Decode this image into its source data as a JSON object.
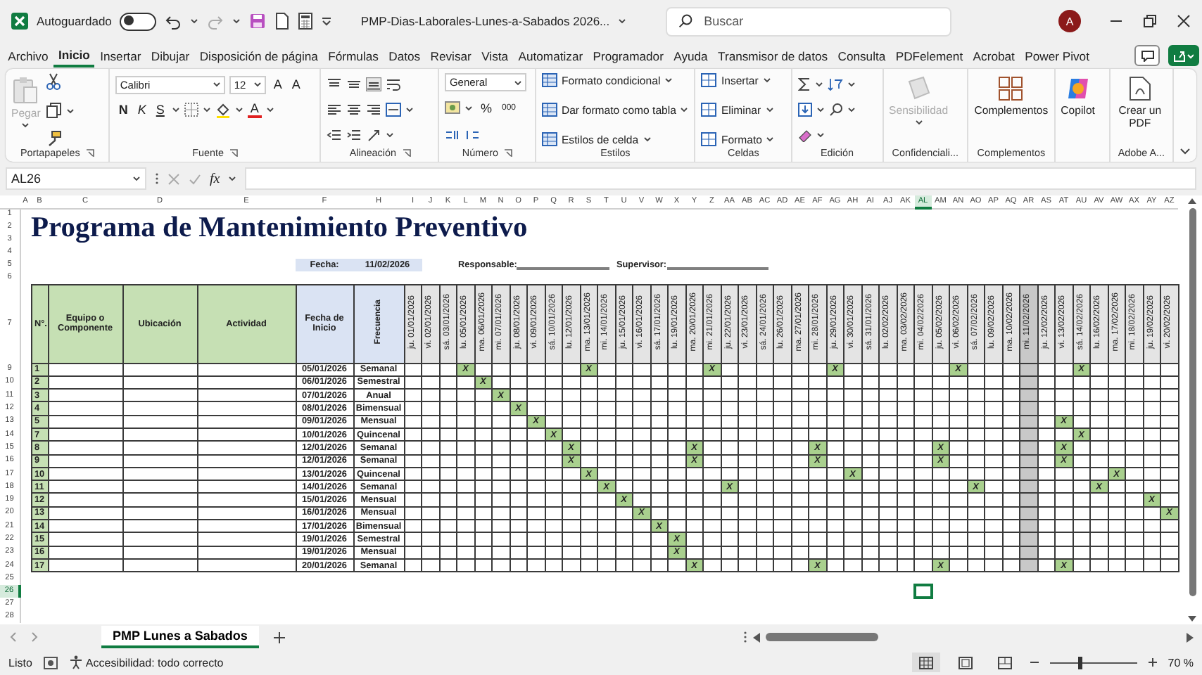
{
  "title_bar": {
    "autosave_label": "Autoguardado",
    "autosave_on": false,
    "file_name": "PMP-Dias-Laborales-Lunes-a-Sabados 2026...",
    "search_placeholder": "Buscar",
    "avatar": "A"
  },
  "menu_tabs": [
    {
      "label": "Archivo",
      "selected": false
    },
    {
      "label": "Inicio",
      "selected": true
    },
    {
      "label": "Insertar",
      "selected": false
    },
    {
      "label": "Dibujar",
      "selected": false
    },
    {
      "label": "Disposición de página",
      "selected": false
    },
    {
      "label": "Fórmulas",
      "selected": false
    },
    {
      "label": "Datos",
      "selected": false
    },
    {
      "label": "Revisar",
      "selected": false
    },
    {
      "label": "Vista",
      "selected": false
    },
    {
      "label": "Automatizar",
      "selected": false
    },
    {
      "label": "Programador",
      "selected": false
    },
    {
      "label": "Ayuda",
      "selected": false
    },
    {
      "label": "Transmisor de datos",
      "selected": false
    },
    {
      "label": "Consulta",
      "selected": false
    },
    {
      "label": "PDFelement",
      "selected": false
    },
    {
      "label": "Acrobat",
      "selected": false
    },
    {
      "label": "Power Pivot",
      "selected": false
    }
  ],
  "ribbon": {
    "clipboard": {
      "paste": "Pegar",
      "label": "Portapapeles"
    },
    "font": {
      "name": "Calibri",
      "size": "12",
      "grow": "A",
      "shrink": "A",
      "bold": "N",
      "italic": "K",
      "underline": "S",
      "font_color_button": "A",
      "label": "Fuente"
    },
    "alignment": {
      "label": "Alineación"
    },
    "number": {
      "format": "General",
      "percent": "%",
      "thousands": "000",
      "label": "Número"
    },
    "styles": {
      "items": [
        "Formato condicional",
        "Dar formato como tabla",
        "Estilos de celda"
      ],
      "label": "Estilos"
    },
    "cells": {
      "items": [
        "Insertar",
        "Eliminar",
        "Formato"
      ],
      "label": "Celdas"
    },
    "editing": {
      "label": "Edición"
    },
    "sensitivity": {
      "button": "Sensibilidad",
      "disabled": true,
      "label": "Confidenciali..."
    },
    "addins": {
      "button": "Complementos",
      "label": "Complementos"
    },
    "copilot": {
      "button": "Copilot"
    },
    "adobe": {
      "button": "Crear un PDF",
      "label": "Adobe A..."
    }
  },
  "formula_bar": {
    "name_box": "AL26",
    "function_label": "fx"
  },
  "sheet": {
    "column_letters": [
      {
        "label": "A",
        "selected": false
      },
      {
        "label": "B",
        "selected": false
      },
      {
        "label": "C",
        "selected": false
      },
      {
        "label": "D",
        "selected": false
      },
      {
        "label": "E",
        "selected": false
      },
      {
        "label": "F",
        "selected": false
      },
      {
        "label": "H",
        "selected": false
      },
      {
        "label": "I",
        "selected": false
      },
      {
        "label": "J",
        "selected": false
      },
      {
        "label": "K",
        "selected": false
      },
      {
        "label": "L",
        "selected": false
      },
      {
        "label": "M",
        "selected": false
      },
      {
        "label": "N",
        "selected": false
      },
      {
        "label": "O",
        "selected": false
      },
      {
        "label": "P",
        "selected": false
      },
      {
        "label": "Q",
        "selected": false
      },
      {
        "label": "R",
        "selected": false
      },
      {
        "label": "S",
        "selected": false
      },
      {
        "label": "T",
        "selected": false
      },
      {
        "label": "U",
        "selected": false
      },
      {
        "label": "V",
        "selected": false
      },
      {
        "label": "W",
        "selected": false
      },
      {
        "label": "X",
        "selected": false
      },
      {
        "label": "Y",
        "selected": false
      },
      {
        "label": "Z",
        "selected": false
      },
      {
        "label": "AA",
        "selected": false
      },
      {
        "label": "AB",
        "selected": false
      },
      {
        "label": "AC",
        "selected": false
      },
      {
        "label": "AD",
        "selected": false
      },
      {
        "label": "AE",
        "selected": false
      },
      {
        "label": "AF",
        "selected": false
      },
      {
        "label": "AG",
        "selected": false
      },
      {
        "label": "AH",
        "selected": false
      },
      {
        "label": "AI",
        "selected": false
      },
      {
        "label": "AJ",
        "selected": false
      },
      {
        "label": "AK",
        "selected": false
      },
      {
        "label": "AL",
        "selected": true
      },
      {
        "label": "AM",
        "selected": false
      },
      {
        "label": "AN",
        "selected": false
      },
      {
        "label": "AO",
        "selected": false
      },
      {
        "label": "AP",
        "selected": false
      },
      {
        "label": "AQ",
        "selected": false
      },
      {
        "label": "AR",
        "selected": false
      },
      {
        "label": "AS",
        "selected": false
      },
      {
        "label": "AT",
        "selected": false
      },
      {
        "label": "AU",
        "selected": false
      },
      {
        "label": "AV",
        "selected": false
      },
      {
        "label": "AW",
        "selected": false
      },
      {
        "label": "AX",
        "selected": false
      },
      {
        "label": "AY",
        "selected": false
      },
      {
        "label": "AZ",
        "selected": false
      }
    ],
    "row_numbers": [
      {
        "label": "1",
        "selected": false
      },
      {
        "label": "2",
        "selected": false
      },
      {
        "label": "3",
        "selected": false
      },
      {
        "label": "4",
        "selected": false
      },
      {
        "label": "5",
        "selected": false
      },
      {
        "label": "6",
        "selected": false
      },
      {
        "label": "7",
        "selected": false
      },
      {
        "label": "9",
        "selected": false
      },
      {
        "label": "10",
        "selected": false
      },
      {
        "label": "11",
        "selected": false
      },
      {
        "label": "12",
        "selected": false
      },
      {
        "label": "13",
        "selected": false
      },
      {
        "label": "14",
        "selected": false
      },
      {
        "label": "15",
        "selected": false
      },
      {
        "label": "16",
        "selected": false
      },
      {
        "label": "17",
        "selected": false
      },
      {
        "label": "18",
        "selected": false
      },
      {
        "label": "19",
        "selected": false
      },
      {
        "label": "20",
        "selected": false
      },
      {
        "label": "21",
        "selected": false
      },
      {
        "label": "22",
        "selected": false
      },
      {
        "label": "23",
        "selected": false
      },
      {
        "label": "24",
        "selected": false
      },
      {
        "label": "25",
        "selected": false
      },
      {
        "label": "26",
        "selected": true
      },
      {
        "label": "27",
        "selected": false
      },
      {
        "label": "28",
        "selected": false
      }
    ],
    "title": "Programa de Mantenimiento Preventivo",
    "fecha_label": "Fecha:",
    "fecha_value": "11/02/2026",
    "responsable_label": "Responsable:",
    "supervisor_label": "Supervisor:",
    "headers": [
      "N°.",
      "Equipo o Componente",
      "Ubicación",
      "Actividad",
      "Fecha de Inicio",
      "Frecuencia"
    ],
    "dates": [
      {
        "label": "ju. 01/01/2026",
        "highlighted": false
      },
      {
        "label": "vi. 02/01/2026",
        "highlighted": false
      },
      {
        "label": "sá. 03/01/2026",
        "highlighted": false
      },
      {
        "label": "lu. 05/01/2026",
        "highlighted": false
      },
      {
        "label": "ma. 06/01/2026",
        "highlighted": false
      },
      {
        "label": "mi. 07/01/2026",
        "highlighted": false
      },
      {
        "label": "ju. 08/01/2026",
        "highlighted": false
      },
      {
        "label": "vi. 09/01/2026",
        "highlighted": false
      },
      {
        "label": "sá. 10/01/2026",
        "highlighted": false
      },
      {
        "label": "lu. 12/01/2026",
        "highlighted": false
      },
      {
        "label": "ma. 13/01/2026",
        "highlighted": false
      },
      {
        "label": "mi. 14/01/2026",
        "highlighted": false
      },
      {
        "label": "ju. 15/01/2026",
        "highlighted": false
      },
      {
        "label": "vi. 16/01/2026",
        "highlighted": false
      },
      {
        "label": "sá. 17/01/2026",
        "highlighted": false
      },
      {
        "label": "lu. 19/01/2026",
        "highlighted": false
      },
      {
        "label": "ma. 20/01/2026",
        "highlighted": false
      },
      {
        "label": "mi. 21/01/2026",
        "highlighted": false
      },
      {
        "label": "ju. 22/01/2026",
        "highlighted": false
      },
      {
        "label": "vi. 23/01/2026",
        "highlighted": false
      },
      {
        "label": "sá. 24/01/2026",
        "highlighted": false
      },
      {
        "label": "lu. 26/01/2026",
        "highlighted": false
      },
      {
        "label": "ma. 27/01/2026",
        "highlighted": false
      },
      {
        "label": "mi. 28/01/2026",
        "highlighted": false
      },
      {
        "label": "ju. 29/01/2026",
        "highlighted": false
      },
      {
        "label": "vi. 30/01/2026",
        "highlighted": false
      },
      {
        "label": "sá. 31/01/2026",
        "highlighted": false
      },
      {
        "label": "lu. 02/02/2026",
        "highlighted": false
      },
      {
        "label": "ma. 03/02/2026",
        "highlighted": false
      },
      {
        "label": "mi. 04/02/2026",
        "highlighted": false
      },
      {
        "label": "ju. 05/02/2026",
        "highlighted": false
      },
      {
        "label": "vi. 06/02/2026",
        "highlighted": false
      },
      {
        "label": "sá. 07/02/2026",
        "highlighted": false
      },
      {
        "label": "lu. 09/02/2026",
        "highlighted": false
      },
      {
        "label": "ma. 10/02/2026",
        "highlighted": false
      },
      {
        "label": "mi. 11/02/2026",
        "highlighted": true
      },
      {
        "label": "ju. 12/02/2026",
        "highlighted": false
      },
      {
        "label": "vi. 13/02/2026",
        "highlighted": false
      },
      {
        "label": "sá. 14/02/2026",
        "highlighted": false
      },
      {
        "label": "lu. 16/02/2026",
        "highlighted": false
      },
      {
        "label": "ma. 17/02/2026",
        "highlighted": false
      },
      {
        "label": "mi. 18/02/2026",
        "highlighted": false
      },
      {
        "label": "ju. 19/02/2026",
        "highlighted": false
      },
      {
        "label": "vi. 20/02/2026",
        "highlighted": false
      }
    ],
    "rows": [
      {
        "no": "1",
        "fecha": "05/01/2026",
        "frecuencia": "Semanal",
        "mark_texts": [
          "X",
          "X",
          "X",
          "X",
          "X",
          "X"
        ],
        "marked": [
          false,
          false,
          false,
          true,
          false,
          false,
          false,
          false,
          false,
          false,
          true,
          false,
          false,
          false,
          false,
          false,
          false,
          true,
          false,
          false,
          false,
          false,
          false,
          false,
          true,
          false,
          false,
          false,
          false,
          false,
          false,
          true,
          false,
          false,
          false,
          false,
          false,
          false,
          true,
          false,
          false,
          false,
          false,
          false
        ]
      },
      {
        "no": "2",
        "fecha": "06/01/2026",
        "frecuencia": "Semestral",
        "mark_texts": [
          "X"
        ],
        "marked": [
          false,
          false,
          false,
          false,
          true,
          false,
          false,
          false,
          false,
          false,
          false,
          false,
          false,
          false,
          false,
          false,
          false,
          false,
          false,
          false,
          false,
          false,
          false,
          false,
          false,
          false,
          false,
          false,
          false,
          false,
          false,
          false,
          false,
          false,
          false,
          false,
          false,
          false,
          false,
          false,
          false,
          false,
          false,
          false
        ]
      },
      {
        "no": "3",
        "fecha": "07/01/2026",
        "frecuencia": "Anual",
        "mark_texts": [
          "X"
        ],
        "marked": [
          false,
          false,
          false,
          false,
          false,
          true,
          false,
          false,
          false,
          false,
          false,
          false,
          false,
          false,
          false,
          false,
          false,
          false,
          false,
          false,
          false,
          false,
          false,
          false,
          false,
          false,
          false,
          false,
          false,
          false,
          false,
          false,
          false,
          false,
          false,
          false,
          false,
          false,
          false,
          false,
          false,
          false,
          false,
          false
        ]
      },
      {
        "no": "4",
        "fecha": "08/01/2026",
        "frecuencia": "Bimensual",
        "mark_texts": [
          "X"
        ],
        "marked": [
          false,
          false,
          false,
          false,
          false,
          false,
          true,
          false,
          false,
          false,
          false,
          false,
          false,
          false,
          false,
          false,
          false,
          false,
          false,
          false,
          false,
          false,
          false,
          false,
          false,
          false,
          false,
          false,
          false,
          false,
          false,
          false,
          false,
          false,
          false,
          false,
          false,
          false,
          false,
          false,
          false,
          false,
          false,
          false
        ]
      },
      {
        "no": "5",
        "fecha": "09/01/2026",
        "frecuencia": "Mensual",
        "mark_texts": [
          "X",
          "X"
        ],
        "marked": [
          false,
          false,
          false,
          false,
          false,
          false,
          false,
          true,
          false,
          false,
          false,
          false,
          false,
          false,
          false,
          false,
          false,
          false,
          false,
          false,
          false,
          false,
          false,
          false,
          false,
          false,
          false,
          false,
          false,
          false,
          false,
          false,
          false,
          false,
          false,
          false,
          false,
          true,
          false,
          false,
          false,
          false,
          false,
          false
        ]
      },
      {
        "no": "7",
        "fecha": "10/01/2026",
        "frecuencia": "Quincenal",
        "mark_texts": [
          "X",
          "X"
        ],
        "marked": [
          false,
          false,
          false,
          false,
          false,
          false,
          false,
          false,
          true,
          false,
          false,
          false,
          false,
          false,
          false,
          false,
          false,
          false,
          false,
          false,
          false,
          false,
          false,
          false,
          false,
          false,
          false,
          false,
          false,
          false,
          false,
          false,
          false,
          false,
          false,
          false,
          false,
          false,
          true,
          false,
          false,
          false,
          false,
          false
        ]
      },
      {
        "no": "8",
        "fecha": "12/01/2026",
        "frecuencia": "Semanal",
        "mark_texts": [
          "X",
          "X",
          "X",
          "X",
          "X"
        ],
        "marked": [
          false,
          false,
          false,
          false,
          false,
          false,
          false,
          false,
          false,
          true,
          false,
          false,
          false,
          false,
          false,
          false,
          true,
          false,
          false,
          false,
          false,
          false,
          false,
          true,
          false,
          false,
          false,
          false,
          false,
          false,
          true,
          false,
          false,
          false,
          false,
          false,
          false,
          true,
          false,
          false,
          false,
          false,
          false,
          false
        ]
      },
      {
        "no": "9",
        "fecha": "12/01/2026",
        "frecuencia": "Semanal",
        "mark_texts": [
          "X",
          "X",
          "X",
          "X",
          "X"
        ],
        "marked": [
          false,
          false,
          false,
          false,
          false,
          false,
          false,
          false,
          false,
          true,
          false,
          false,
          false,
          false,
          false,
          false,
          true,
          false,
          false,
          false,
          false,
          false,
          false,
          true,
          false,
          false,
          false,
          false,
          false,
          false,
          true,
          false,
          false,
          false,
          false,
          false,
          false,
          true,
          false,
          false,
          false,
          false,
          false,
          false
        ]
      },
      {
        "no": "10",
        "fecha": "13/01/2026",
        "frecuencia": "Quincenal",
        "mark_texts": [
          "X",
          "X",
          "X"
        ],
        "marked": [
          false,
          false,
          false,
          false,
          false,
          false,
          false,
          false,
          false,
          false,
          true,
          false,
          false,
          false,
          false,
          false,
          false,
          false,
          false,
          false,
          false,
          false,
          false,
          false,
          false,
          true,
          false,
          false,
          false,
          false,
          false,
          false,
          false,
          false,
          false,
          false,
          false,
          false,
          false,
          false,
          true,
          false,
          false,
          false
        ]
      },
      {
        "no": "11",
        "fecha": "14/01/2026",
        "frecuencia": "Semanal",
        "mark_texts": [
          "X",
          "X",
          "X",
          "X"
        ],
        "marked": [
          false,
          false,
          false,
          false,
          false,
          false,
          false,
          false,
          false,
          false,
          false,
          true,
          false,
          false,
          false,
          false,
          false,
          false,
          true,
          false,
          false,
          false,
          false,
          false,
          false,
          false,
          false,
          false,
          false,
          false,
          false,
          false,
          true,
          false,
          false,
          false,
          false,
          false,
          false,
          true,
          false,
          false,
          false,
          false
        ]
      },
      {
        "no": "12",
        "fecha": "15/01/2026",
        "frecuencia": "Mensual",
        "mark_texts": [
          "X",
          "X"
        ],
        "marked": [
          false,
          false,
          false,
          false,
          false,
          false,
          false,
          false,
          false,
          false,
          false,
          false,
          true,
          false,
          false,
          false,
          false,
          false,
          false,
          false,
          false,
          false,
          false,
          false,
          false,
          false,
          false,
          false,
          false,
          false,
          false,
          false,
          false,
          false,
          false,
          false,
          false,
          false,
          false,
          false,
          false,
          false,
          true,
          false
        ]
      },
      {
        "no": "13",
        "fecha": "16/01/2026",
        "frecuencia": "Mensual",
        "mark_texts": [
          "X",
          "X"
        ],
        "marked": [
          false,
          false,
          false,
          false,
          false,
          false,
          false,
          false,
          false,
          false,
          false,
          false,
          false,
          true,
          false,
          false,
          false,
          false,
          false,
          false,
          false,
          false,
          false,
          false,
          false,
          false,
          false,
          false,
          false,
          false,
          false,
          false,
          false,
          false,
          false,
          false,
          false,
          false,
          false,
          false,
          false,
          false,
          false,
          true
        ]
      },
      {
        "no": "14",
        "fecha": "17/01/2026",
        "frecuencia": "Bimensual",
        "mark_texts": [
          "X"
        ],
        "marked": [
          false,
          false,
          false,
          false,
          false,
          false,
          false,
          false,
          false,
          false,
          false,
          false,
          false,
          false,
          true,
          false,
          false,
          false,
          false,
          false,
          false,
          false,
          false,
          false,
          false,
          false,
          false,
          false,
          false,
          false,
          false,
          false,
          false,
          false,
          false,
          false,
          false,
          false,
          false,
          false,
          false,
          false,
          false,
          false
        ]
      },
      {
        "no": "15",
        "fecha": "19/01/2026",
        "frecuencia": "Semestral",
        "mark_texts": [
          "X"
        ],
        "marked": [
          false,
          false,
          false,
          false,
          false,
          false,
          false,
          false,
          false,
          false,
          false,
          false,
          false,
          false,
          false,
          true,
          false,
          false,
          false,
          false,
          false,
          false,
          false,
          false,
          false,
          false,
          false,
          false,
          false,
          false,
          false,
          false,
          false,
          false,
          false,
          false,
          false,
          false,
          false,
          false,
          false,
          false,
          false,
          false
        ]
      },
      {
        "no": "16",
        "fecha": "19/01/2026",
        "frecuencia": "Mensual",
        "mark_texts": [
          "X"
        ],
        "marked": [
          false,
          false,
          false,
          false,
          false,
          false,
          false,
          false,
          false,
          false,
          false,
          false,
          false,
          false,
          false,
          true,
          false,
          false,
          false,
          false,
          false,
          false,
          false,
          false,
          false,
          false,
          false,
          false,
          false,
          false,
          false,
          false,
          false,
          false,
          false,
          false,
          false,
          false,
          false,
          false,
          false,
          false,
          false,
          false
        ]
      },
      {
        "no": "17",
        "fecha": "20/01/2026",
        "frecuencia": "Semanal",
        "mark_texts": [
          "X",
          "X",
          "X",
          "X"
        ],
        "marked": [
          false,
          false,
          false,
          false,
          false,
          false,
          false,
          false,
          false,
          false,
          false,
          false,
          false,
          false,
          false,
          false,
          true,
          false,
          false,
          false,
          false,
          false,
          false,
          true,
          false,
          false,
          false,
          false,
          false,
          false,
          true,
          false,
          false,
          false,
          false,
          false,
          false,
          true,
          false,
          false,
          false,
          false,
          false,
          false
        ]
      }
    ]
  },
  "sheet_tabs": [
    {
      "label": "PMP Lunes a Sabados",
      "selected": true
    }
  ],
  "status_bar": {
    "ready": "Listo",
    "accessibility": "Accesibilidad: todo correcto",
    "zoom_slider": {
      "level": 0.35
    },
    "zoom": "70 %"
  }
}
